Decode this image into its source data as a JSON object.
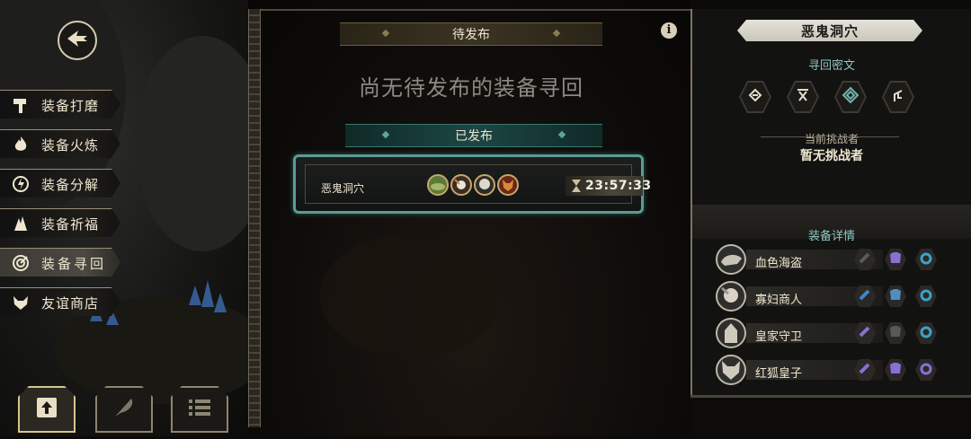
{
  "sidebar": {
    "back_icon": "back-arrow-icon",
    "items": [
      {
        "label": "装备打磨",
        "icon": "hammer-icon",
        "active": false
      },
      {
        "label": "装备火炼",
        "icon": "flame-icon",
        "active": false
      },
      {
        "label": "装备分解",
        "icon": "disassemble-icon",
        "active": false
      },
      {
        "label": "装备祈福",
        "icon": "blessing-icon",
        "active": false
      },
      {
        "label": "装备寻回",
        "icon": "retrieve-icon",
        "active": true
      },
      {
        "label": "友谊商店",
        "icon": "fox-icon",
        "active": false
      }
    ],
    "bottom_buttons": [
      {
        "icon": "upload-icon",
        "active": true
      },
      {
        "icon": "feather-icon",
        "active": false
      },
      {
        "icon": "list-icon",
        "active": false
      }
    ]
  },
  "center": {
    "pending_label": "待发布",
    "empty_message": "尚无待发布的装备寻回",
    "published_label": "已发布",
    "quest": {
      "name": "恶鬼洞穴",
      "timer": "23:57:33",
      "avatar_count": 4
    }
  },
  "right": {
    "title": "恶鬼洞穴",
    "rune_heading": "寻回密文",
    "runes": [
      "rune-a-icon",
      "rune-b-icon",
      "rune-c-icon",
      "rune-d-icon"
    ],
    "challenger_label": "当前挑战者",
    "challenger_value": "暂无挑战者",
    "detail_heading": "装备详情",
    "heroes": [
      {
        "name": "血色海盗",
        "weapon_color": "#4a4944",
        "armor_color": "#8c6fd6",
        "ring_color": "#3fa1c9"
      },
      {
        "name": "寡妇商人",
        "weapon_color": "#3f86c6",
        "armor_color": "#4e8fc2",
        "ring_color": "#3fa1c9"
      },
      {
        "name": "皇家守卫",
        "weapon_color": "#8c6fd6",
        "armor_color": "#4a4944",
        "ring_color": "#3fa1c9"
      },
      {
        "name": "红狐皇子",
        "weapon_color": "#8c6fd6",
        "armor_color": "#8c6fd6",
        "ring_color": "#8c6fd6"
      }
    ]
  },
  "colors": {
    "teal_accent": "#5d9a95",
    "gold_border": "#c9a66b",
    "heading_teal": "#8fc7c0"
  }
}
